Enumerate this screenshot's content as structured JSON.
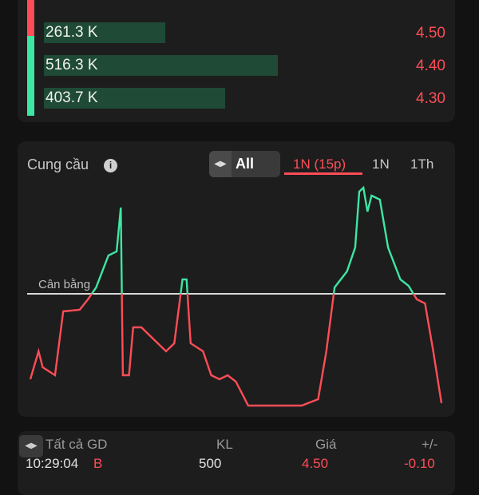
{
  "orderbook": {
    "rows": [
      {
        "volume": "261.3 K",
        "price": "4.50",
        "fill": 0.3
      },
      {
        "volume": "516.3 K",
        "price": "4.40",
        "fill": 0.58
      },
      {
        "volume": "403.7 K",
        "price": "4.30",
        "fill": 0.45
      }
    ]
  },
  "supply_demand": {
    "title": "Cung cầu",
    "toggle_label": "All",
    "tabs": [
      "1N (15p)",
      "1N",
      "1Th"
    ],
    "active_tab": "1N (15p)",
    "balance_label": "Cân bằng",
    "colors": {
      "demand": "#3ee6a4",
      "supply": "#ff4d57",
      "baseline": "#d8d8d8"
    }
  },
  "chart_data": {
    "type": "line",
    "title": "Cung cầu",
    "baseline_label": "Cân bằng",
    "y_range": [
      -100,
      100
    ],
    "x": [
      0,
      1,
      2,
      3,
      4,
      5,
      6,
      7,
      8,
      9,
      10,
      11,
      12,
      13,
      14,
      15,
      16,
      17,
      18,
      19,
      20,
      21,
      22,
      23,
      24,
      25,
      26,
      27,
      28,
      29,
      30,
      31,
      32,
      33,
      34,
      35,
      36,
      37,
      38,
      39,
      40,
      41,
      42,
      43,
      44,
      45,
      46,
      47,
      48,
      49,
      50,
      51,
      52,
      53,
      54,
      55,
      56,
      57,
      58,
      59,
      60,
      61,
      62,
      63,
      64,
      65,
      66,
      67,
      68,
      69,
      70,
      71,
      72,
      73,
      74,
      75,
      76,
      77,
      78,
      79,
      80,
      81,
      82,
      83,
      84,
      85,
      86,
      87,
      88,
      89,
      90,
      91,
      92,
      93,
      94,
      95,
      96,
      97,
      98,
      99,
      100,
      101,
      102,
      103,
      104,
      105,
      106,
      107,
      108,
      109,
      110,
      111,
      112,
      113,
      114,
      115,
      116,
      117,
      118,
      119,
      120,
      121,
      122,
      123,
      124,
      125,
      126,
      127,
      128,
      129,
      130,
      131,
      132,
      133,
      134,
      135,
      136,
      137,
      138,
      139,
      140,
      141,
      142,
      143,
      144,
      145,
      146,
      147,
      148,
      149,
      150,
      151,
      152,
      153,
      154,
      155,
      156,
      157,
      158,
      159,
      160,
      161,
      162,
      163,
      164,
      165,
      166,
      167,
      168,
      169,
      170,
      171,
      172,
      173,
      174,
      175,
      176,
      177,
      178,
      179,
      180,
      181,
      182,
      183,
      184,
      185,
      186,
      187,
      188,
      189,
      190,
      191,
      192,
      193,
      194,
      195,
      196,
      197,
      198,
      199,
      200,
      201,
      202,
      203,
      204,
      205,
      206,
      207,
      208,
      209,
      210,
      211,
      212,
      213,
      214,
      215,
      216,
      217,
      218,
      219,
      220,
      221,
      222,
      223,
      224,
      225,
      226,
      227,
      228,
      229,
      230,
      231,
      232,
      233,
      234,
      235,
      236,
      237,
      238,
      239,
      240,
      241,
      242,
      243,
      244,
      245,
      246,
      247,
      248,
      249,
      250,
      251,
      252,
      253,
      254,
      255,
      256,
      257,
      258,
      259,
      260,
      261,
      262,
      263,
      264,
      265,
      266,
      267,
      268,
      269,
      270,
      271,
      272,
      273,
      274,
      275,
      276,
      277,
      278,
      279,
      280,
      281,
      282,
      283,
      284,
      285,
      286,
      287,
      288,
      289,
      290,
      291,
      292,
      293,
      294,
      295,
      296,
      297,
      298,
      299,
      300,
      301,
      302,
      303,
      304,
      305,
      306,
      307,
      308,
      309,
      310,
      311,
      312,
      313,
      314,
      315,
      316,
      317,
      318,
      319,
      320,
      321,
      322,
      323,
      324,
      325,
      326,
      327,
      328,
      329,
      330,
      331,
      332,
      333,
      334,
      335,
      336,
      337,
      338,
      339,
      340,
      341,
      342,
      343,
      344,
      345,
      346,
      347,
      348,
      349,
      350,
      351,
      352,
      353,
      354,
      355,
      356,
      357,
      358,
      359,
      360,
      361,
      362,
      363,
      364,
      365,
      366,
      367,
      368,
      369,
      370,
      371,
      372,
      373,
      374,
      375,
      376,
      377,
      378,
      379,
      380,
      381,
      382,
      383,
      384,
      385,
      386,
      387,
      388,
      389,
      390,
      391,
      392,
      393,
      394,
      395,
      396,
      397,
      398,
      399,
      400,
      401,
      402,
      403,
      404,
      405,
      406,
      407,
      408,
      409,
      410,
      411,
      412,
      413,
      414,
      415,
      416,
      417,
      418,
      419,
      420,
      421,
      422,
      423,
      424,
      425,
      426,
      427,
      428,
      429,
      430,
      431,
      432,
      433,
      434,
      435,
      436,
      437,
      438,
      439,
      440,
      441,
      442,
      443,
      444,
      445,
      446,
      447,
      448,
      449,
      450,
      451,
      452,
      453,
      454,
      455,
      456,
      457,
      458,
      459,
      460,
      461,
      462,
      463,
      464,
      465,
      466,
      467,
      468,
      469,
      470,
      471,
      472,
      473,
      474,
      475,
      476,
      477,
      478,
      479,
      480,
      481,
      482,
      483,
      484,
      485,
      486,
      487,
      488,
      489,
      490,
      491,
      492,
      493,
      494,
      495,
      496,
      497,
      498,
      499,
      500,
      501,
      502,
      503,
      504,
      505,
      506,
      507,
      508,
      509,
      510,
      511,
      512,
      513,
      514,
      515,
      516,
      517
    ],
    "y": []
  },
  "trades": {
    "header": {
      "all": "Tất cả GD",
      "kl": "KL",
      "price": "Giá",
      "change": "+/-"
    },
    "rows": [
      {
        "time": "10:29:04",
        "side": "B",
        "kl": "500",
        "price": "4.50",
        "change": "-0.10"
      }
    ]
  }
}
